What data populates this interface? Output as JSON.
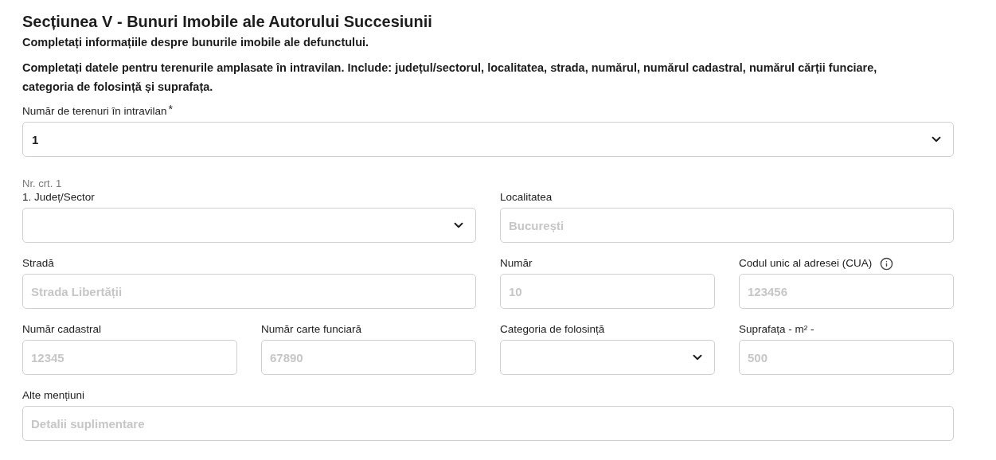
{
  "section": {
    "title": "Secțiunea V - Bunuri Imobile ale Autorului Succesiunii",
    "subtitle": "Completați informațiile despre bunurile imobile ale defunctului.",
    "instructions": "Completați datele pentru terenurile amplasate în intravilan. Include: județul/sectorul, localitatea, strada, numărul, numărul cadastral, numărul cărții funciare, categoria de folosință și suprafața."
  },
  "count_field": {
    "kind": "select",
    "label": "Număr de terenuri în intravilan",
    "required_mark": "*",
    "value": "1"
  },
  "entry": {
    "number_label": "Nr. crt. 1",
    "field_groups": [
      {
        "fields": [
          {
            "kind": "select",
            "label": "1. Județ/Sector"
          },
          {
            "kind": "text",
            "label": "Localitatea",
            "placeholder": "București"
          }
        ]
      },
      {
        "fields": [
          {
            "kind": "text",
            "label": "Stradă",
            "placeholder": "Strada Libertății"
          },
          {
            "kind": "text",
            "label": "Număr",
            "placeholder": "10"
          },
          {
            "kind": "text",
            "label": "Codul unic al adresei (CUA)",
            "placeholder": "123456",
            "info": true
          }
        ]
      },
      {
        "fields": [
          {
            "kind": "text",
            "label": "Număr cadastral",
            "placeholder": "12345"
          },
          {
            "kind": "text",
            "label": "Număr carte funciară",
            "placeholder": "67890"
          },
          {
            "kind": "select",
            "label": "Categoria de folosință"
          },
          {
            "kind": "text",
            "label": "Suprafața - m² -",
            "placeholder": "500"
          }
        ]
      },
      {
        "fields": [
          {
            "kind": "text",
            "label": "Alte mențiuni",
            "placeholder": "Detalii suplimentare"
          }
        ]
      }
    ]
  }
}
